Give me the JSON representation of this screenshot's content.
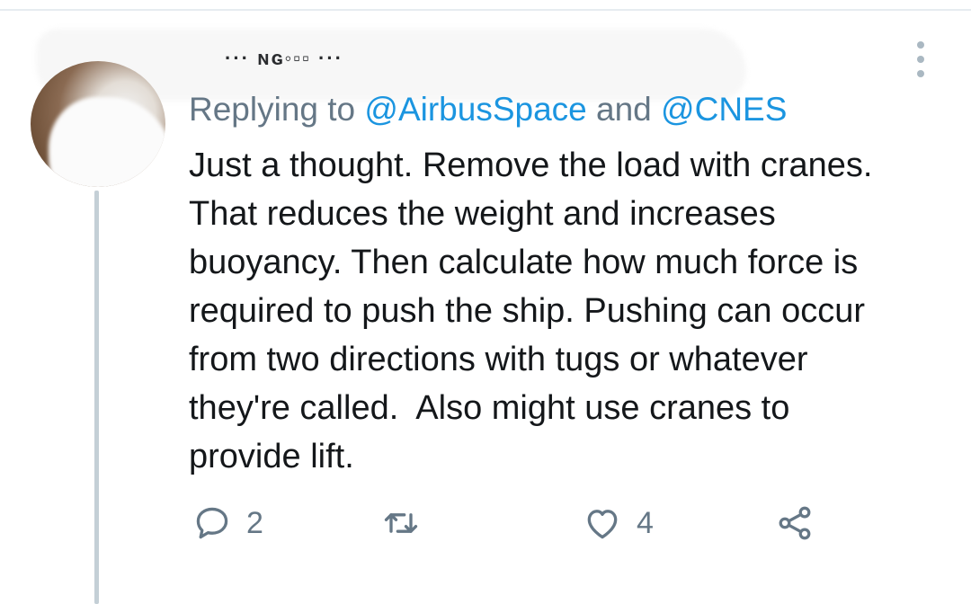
{
  "tweet": {
    "author_name": "··· ɴɢ◦▫▫ ···",
    "reply_prefix": "Replying to ",
    "mentions": [
      "@AirbusSpace",
      "@CNES"
    ],
    "mention_joiner": " and ",
    "text": "Just a thought. Remove the load with cranes.\nThat reduces the weight and increases\nbuoyancy. Then calculate how much force is\nrequired to push the ship. Pushing can occur\nfrom two directions with tugs or whatever\nthey're called.  Also might use cranes to\nprovide lift."
  },
  "actions": {
    "reply_count": "2",
    "retweet_count": "",
    "like_count": "4"
  },
  "icons": {
    "reply": "reply-bubble-icon",
    "retweet": "retweet-icon",
    "like": "heart-icon",
    "share": "share-icon",
    "more": "more-vertical-icon"
  },
  "colors": {
    "accent": "#1b95e0",
    "muted": "#657786",
    "icon": "#657786",
    "thread_line": "#c4cfd6"
  }
}
